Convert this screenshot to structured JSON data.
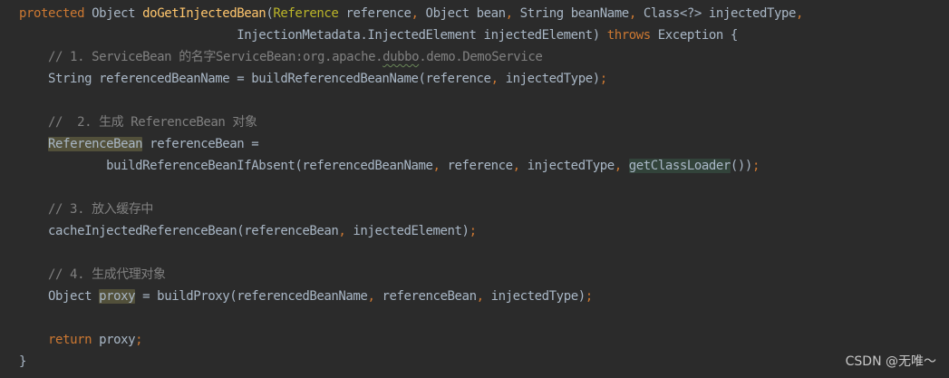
{
  "editor": {
    "theme": "darcula",
    "background": "#2b2b2b",
    "colors": {
      "keyword": "#cc7832",
      "method": "#ffc66d",
      "annotation_type": "#bbb529",
      "comment": "#808080",
      "default": "#a9b7c6"
    },
    "lines": {
      "l1": {
        "kw_protected": "protected",
        "t_object": " Object ",
        "fn_name": "doGetInjectedBean",
        "t_open": "(",
        "ann_reference": "Reference",
        "t_ref": " reference",
        "comma1": ",",
        "t_objbean": " Object bean",
        "comma2": ",",
        "t_string": " String beanName",
        "comma3": ",",
        "t_class": " Class<?> injectedType",
        "comma4": ","
      },
      "l2": {
        "indent": "                              ",
        "t_meta": "InjectionMetadata.InjectedElement injectedElement) ",
        "kw_throws": "throws",
        "t_exc": " Exception {"
      },
      "l3": {
        "cm_a": "    // 1. ServiceBean 的名字ServiceBean:org.apache.",
        "cm_dubbo": "dubbo",
        "cm_b": ".demo.DemoService"
      },
      "l4": {
        "t_a": "    String referencedBeanName = buildReferencedBeanName(reference",
        "comma1": ",",
        "t_b": " injectedType)",
        "semi": ";"
      },
      "l6": {
        "cm": "    //  2. 生成 ReferenceBean 对象"
      },
      "l7": {
        "indent": "    ",
        "hl_type": "ReferenceBean",
        "t_rest": " referenceBean ="
      },
      "l8": {
        "t_a": "            buildReferenceBeanIfAbsent(referencedBeanName",
        "comma1": ",",
        "t_b": " reference",
        "comma2": ",",
        "t_c": " injectedType",
        "comma3": ",",
        "t_sp": " ",
        "hl_fn": "getClassLoader",
        "t_d": "())",
        "semi": ";"
      },
      "l10": {
        "cm": "    // 3. 放入缓存中"
      },
      "l11": {
        "t_a": "    cacheInjectedReferenceBean(referenceBean",
        "comma1": ",",
        "t_b": " injectedElement)",
        "semi": ";"
      },
      "l13": {
        "cm": "    // 4. 生成代理对象"
      },
      "l14": {
        "t_a": "    Object ",
        "hl_proxy": "proxy",
        "t_b": " = buildProxy(referencedBeanName",
        "comma1": ",",
        "t_c": " referenceBean",
        "comma2": ",",
        "t_d": " injectedType)",
        "semi": ";"
      },
      "l16": {
        "indent": "    ",
        "kw_return": "return",
        "t_proxy": " proxy",
        "semi": ";"
      },
      "l17": {
        "t_close": "}"
      }
    }
  },
  "watermark": {
    "text": "CSDN @无唯～"
  }
}
